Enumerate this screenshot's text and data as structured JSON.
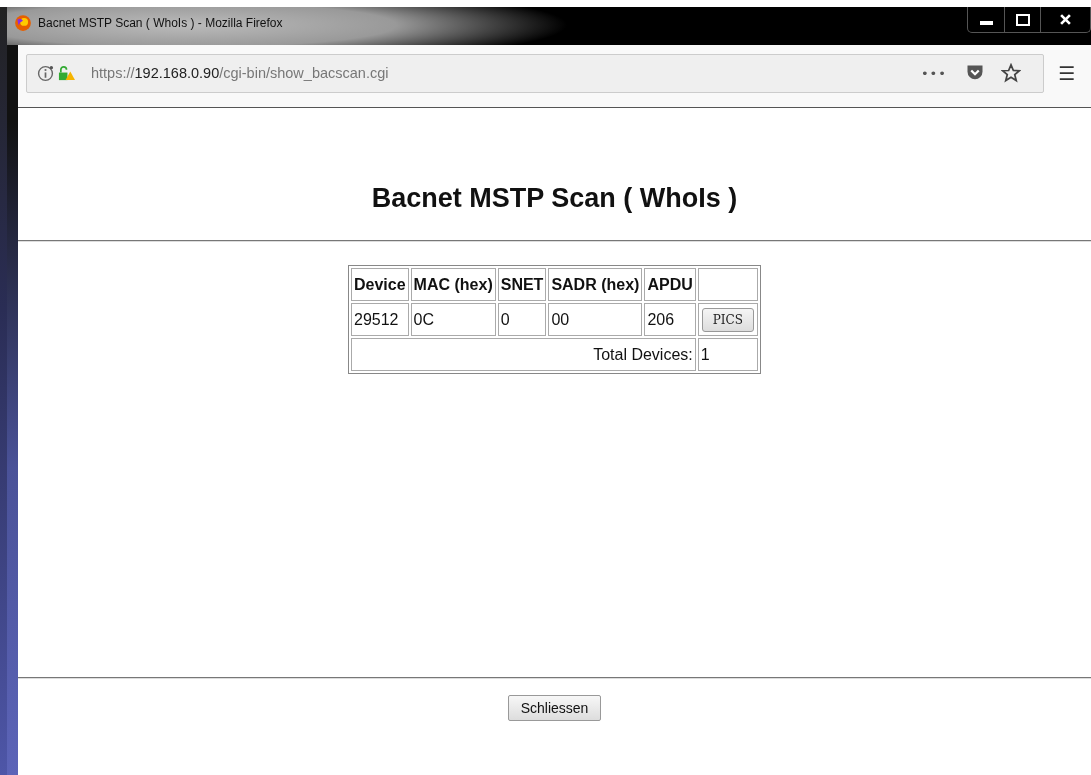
{
  "window": {
    "title": "Bacnet MSTP Scan ( WhoIs ) - Mozilla Firefox"
  },
  "address_bar": {
    "scheme": "https://",
    "host": "192.168.0.90",
    "path": "/cgi-bin/show_bacscan.cgi",
    "more": "•••",
    "menu": "☰"
  },
  "page": {
    "heading": "Bacnet MSTP Scan ( WhoIs )",
    "table": {
      "columns": [
        "Device",
        "MAC (hex)",
        "SNET",
        "SADR (hex)",
        "APDU"
      ],
      "rows": [
        {
          "cells": [
            "29512",
            "0C",
            "0",
            "00",
            "206"
          ],
          "button": "PICS"
        }
      ],
      "total_label": "Total Devices:",
      "total_value": "1"
    },
    "close_button": "Schliessen"
  }
}
